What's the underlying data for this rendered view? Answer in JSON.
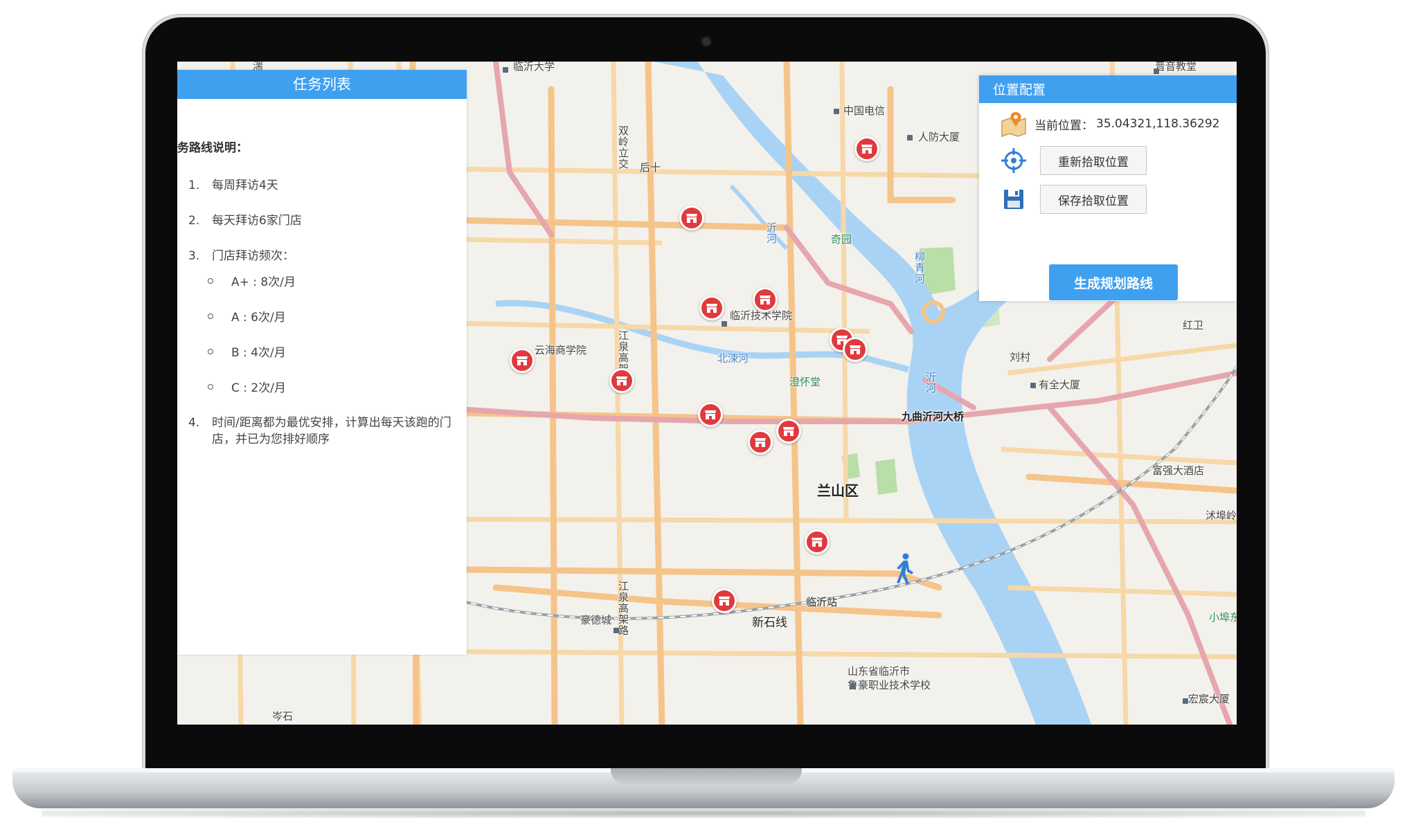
{
  "task_panel": {
    "title": "任务列表",
    "heading": "务路线说明：",
    "items": [
      {
        "num": "1.",
        "text": "每周拜访4天"
      },
      {
        "num": "2.",
        "text": "每天拜访6家门店"
      },
      {
        "num": "3.",
        "text": "门店拜访频次："
      },
      {
        "num": "4.",
        "text": "时间/距离都为最优安排，计算出每天该跑的门店，并已为您排好顺序"
      }
    ],
    "frequency": [
      "A+ : 8次/月",
      "A : 6次/月",
      "B : 4次/月",
      "C : 2次/月"
    ]
  },
  "location_panel": {
    "title": "位置配置",
    "current_label": "当前位置：",
    "current_value": "35.04321,118.36292",
    "repick_button": "重新拾取位置",
    "save_button": "保存拾取位置",
    "generate_button": "生成规划路线"
  },
  "map": {
    "district": "兰山区",
    "labels": {
      "linyi_univ": "临沂大学",
      "china_telecom": "中国电信",
      "renfang": "人防大厦",
      "shuanglingjiao": "双岭立交",
      "houshi": "后十",
      "yi_river": "沂河",
      "qiyuan": "奇园",
      "liuqing_river": "柳青河",
      "tech_college": "临沂技术学院",
      "yunhai": "云海商学院",
      "beitao_river": "北涑河",
      "jiangquan_rd": "江泉高架路",
      "jiangquan_rd2": "江泉高架路",
      "zhihuaitang": "澄怀堂",
      "yi_river2": "沂河",
      "jiuqu_bridge": "九曲沂河大桥",
      "liucun": "刘村",
      "youquan": "有全大厦",
      "hongwei": "红卫",
      "fuqiang": "富强大酒店",
      "mufuling": "沭埠岭",
      "linyi_station": "临沂站",
      "xinshi_line": "新石线",
      "haodecheng": "豪德城",
      "luhao_school1": "山东省临沂市",
      "luhao_school2": "鲁豪职业技术学校",
      "hongyuan": "宏宸大厦",
      "xiaopo": "小埠东",
      "censhi": "岑石",
      "jiangshen": "湍江路",
      "top_right": "晋音教堂"
    }
  },
  "colors": {
    "accent": "#3fa0f0",
    "marker": "#e03a3e",
    "water": "#a9d3f5",
    "road_main": "#f5c48a",
    "road_rail": "#e6a6ad"
  }
}
